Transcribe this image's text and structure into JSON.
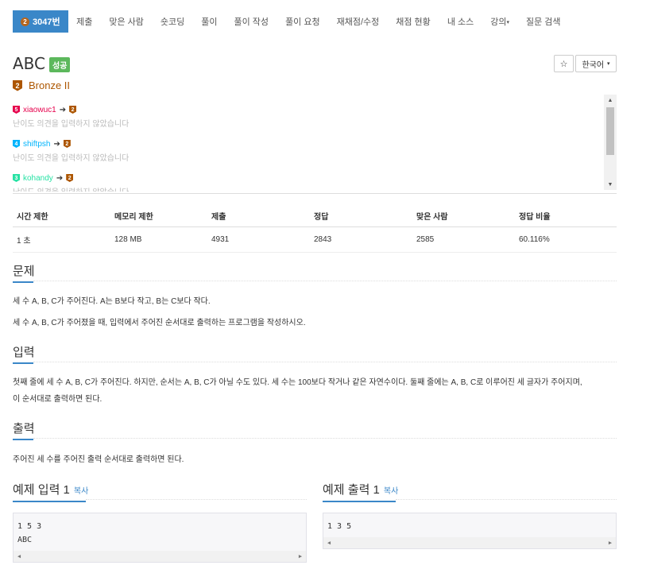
{
  "nav": {
    "active": {
      "badge": "2",
      "label": "3047번"
    },
    "items": [
      "제출",
      "맞은 사람",
      "숏코딩",
      "풀이",
      "풀이 작성",
      "풀이 요청",
      "재채점/수정",
      "채점 현황",
      "내 소스",
      "강의",
      "질문 검색"
    ],
    "caret": "▾"
  },
  "problem": {
    "title": "ABC",
    "status": "성공",
    "tier_badge": "2",
    "tier": "Bronze II",
    "star": "☆",
    "language": "한국어",
    "language_caret": "▾"
  },
  "opinions": [
    {
      "user": "xiaowuc1",
      "from_badge": "5",
      "from_color": "#e6004c",
      "to_badge": "2",
      "to_color": "#ad5600",
      "user_color": "#e6004c",
      "text": "난이도 의견을 입력하지 않았습니다"
    },
    {
      "user": "shiftpsh",
      "from_badge": "4",
      "from_color": "#00b4fc",
      "to_badge": "2",
      "to_color": "#ad5600",
      "user_color": "#00b4fc",
      "text": "난이도 의견을 입력하지 않았습니다"
    },
    {
      "user": "kohandy",
      "from_badge": "3",
      "from_color": "#27e2a4",
      "to_badge": "2",
      "to_color": "#ad5600",
      "user_color": "#27e2a4",
      "text": "난이도 의견을 입력하지 않았습니다"
    }
  ],
  "opinion_arrow": "➔",
  "info": {
    "headers": [
      "시간 제한",
      "메모리 제한",
      "제출",
      "정답",
      "맞은 사람",
      "정답 비율"
    ],
    "values": [
      "1 초",
      "128 MB",
      "4931",
      "2843",
      "2585",
      "60.116%"
    ]
  },
  "sections": {
    "problem_title": "문제",
    "problem_p1": "세 수 A, B, C가 주어진다. A는 B보다 작고, B는 C보다 작다.",
    "problem_p2": "세 수 A, B, C가 주어졌을 때, 입력에서 주어진 순서대로 출력하는 프로그램을 작성하시오.",
    "input_title": "입력",
    "input_p1": "첫째 줄에 세 수 A, B, C가 주어진다. 하지만, 순서는 A, B, C가 아닐 수도 있다. 세 수는 100보다 작거나 같은 자연수이다. 둘째 줄에는 A, B, C로 이루어진 세 글자가 주어지며,",
    "input_p2": "이 순서대로 출력하면 된다.",
    "output_title": "출력",
    "output_p1": "주어진 세 수를 주어진 출력 순서대로 출력하면 된다."
  },
  "samples": {
    "input_title": "예제 입력 1",
    "input_copy": "복사",
    "input_line1": "1 5 3",
    "input_line2": "ABC",
    "output_title": "예제 출력 1",
    "output_copy": "복사",
    "output_line1": "1 3 5"
  },
  "scroll_arrows": {
    "up": "▲",
    "down": "▼",
    "left": "◀",
    "right": "▶"
  }
}
